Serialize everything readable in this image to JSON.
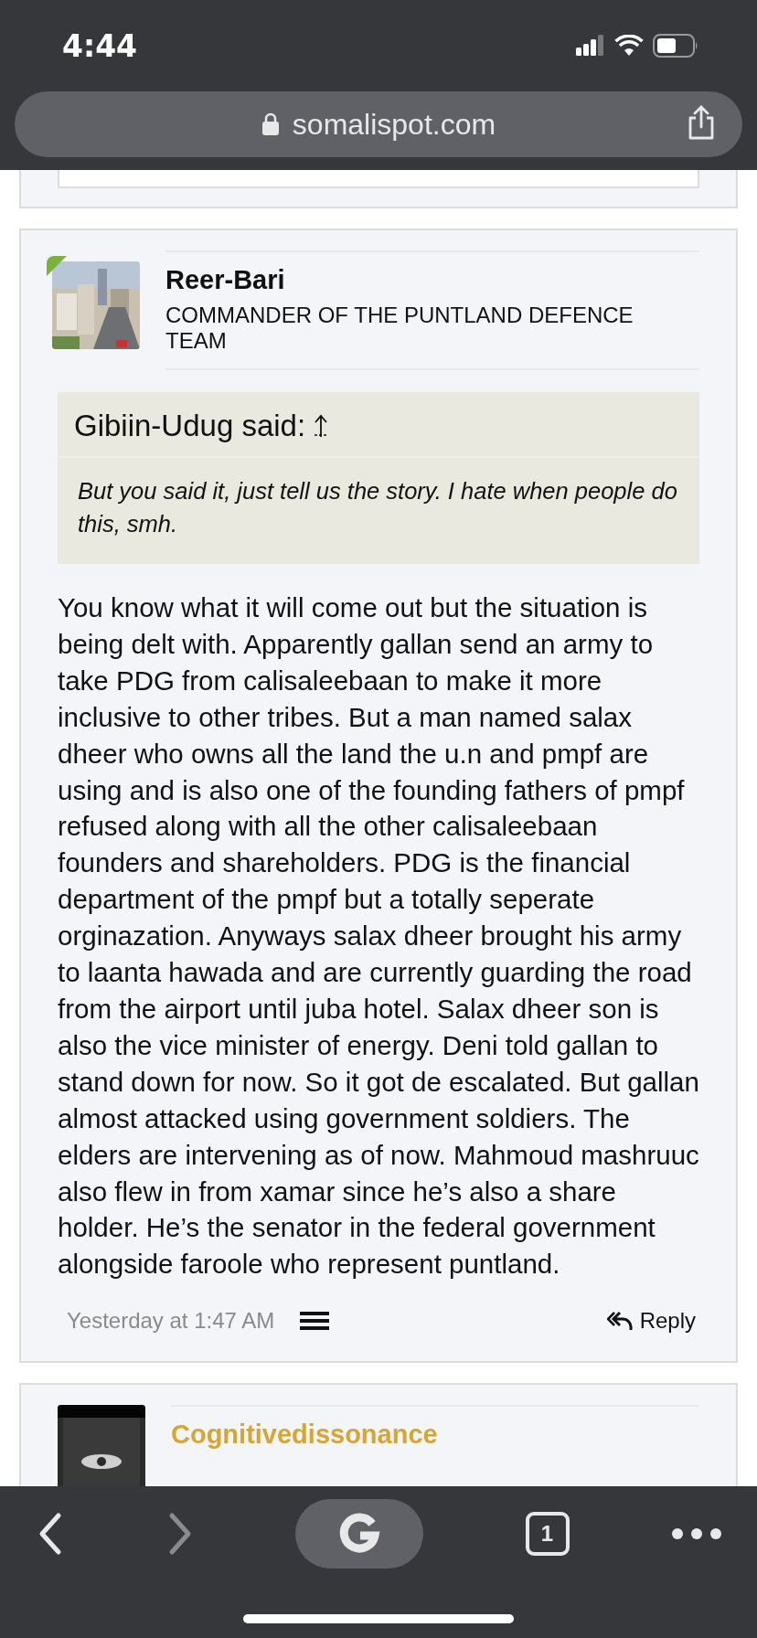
{
  "status_bar": {
    "time": "4:44"
  },
  "address_bar": {
    "url": "somalispot.com",
    "secure": true
  },
  "post": {
    "author": "Reer-Bari",
    "user_title": "COMMANDER OF THE PUNTLAND DEFENCE TEAM",
    "online": true,
    "quote": {
      "attribution": "Gibiin-Udug said:",
      "text": "But you said it, just tell us the story. I hate when people do this, smh."
    },
    "body": "You know what it will come out but the situation is being delt with. Apparently gallan send an army to take PDG from calisaleebaan to make it more inclusive to other tribes. But a man named salax dheer who owns all the land the u.n and pmpf are using and is also one of the founding fathers of pmpf refused along with all the other calisaleebaan founders and shareholders. PDG is the financial department of the pmpf but a totally seperate orginazation. Anyways salax dheer brought his army to laanta hawada and are currently guarding the road from the airport until juba hotel. Salax dheer son is also the vice minister of energy. Deni told gallan to stand down for now. So it got de escalated. But gallan almost attacked using government soldiers. The elders are intervening as of now. Mahmoud mashruuc also flew in from xamar since he’s also a share holder. He’s the senator in the federal government alongside faroole who represent puntland.",
    "date": "Yesterday at 1:47 AM",
    "reply_label": "Reply"
  },
  "next_post": {
    "author": "Cognitivedissonance"
  },
  "toolbar": {
    "tab_count": "1"
  }
}
